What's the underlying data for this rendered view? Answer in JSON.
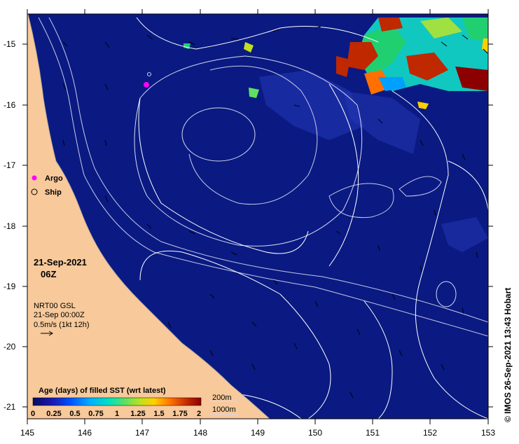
{
  "map": {
    "lat_ticks": [
      "-15",
      "-16",
      "-17",
      "-18",
      "-19",
      "-20",
      "-21"
    ],
    "lon_ticks": [
      "145",
      "146",
      "147",
      "148",
      "149",
      "150",
      "151",
      "152",
      "153"
    ],
    "lon_range": [
      145,
      153
    ],
    "lat_range": [
      -21.2,
      -14.7
    ]
  },
  "legend": {
    "argo_label": "Argo",
    "ship_label": "Ship",
    "argo_color": "#ff00ff",
    "ship_color": "#000000"
  },
  "date_block": {
    "date": "21-Sep-2021",
    "hour": "06Z",
    "product": "NRT00 GSL",
    "time": "21-Sep 00:00Z",
    "scale": "0.5m/s (1kt 12h)"
  },
  "colorbar": {
    "title": "Age (days) of filled SST (wrt latest)",
    "tick_labels": [
      "0",
      "0.25",
      "0.5",
      "0.75",
      "1",
      "1.25",
      "1.5",
      "1.75",
      "2"
    ],
    "colors": [
      "#0a0a64",
      "#1a1ab4",
      "#0050ff",
      "#00a0ff",
      "#00e0e0",
      "#40e080",
      "#a0e040",
      "#ffe000",
      "#ff8000",
      "#c03000",
      "#8c0000"
    ]
  },
  "contours_legend": {
    "depth_200": "200m",
    "depth_1000": "1000m"
  },
  "credit": "© IMOS 26-Sep-2021 13:43 Hobart",
  "colors": {
    "ocean": "#0a1a82",
    "land": "#f7c99b",
    "contour": "#d8d8f0"
  }
}
